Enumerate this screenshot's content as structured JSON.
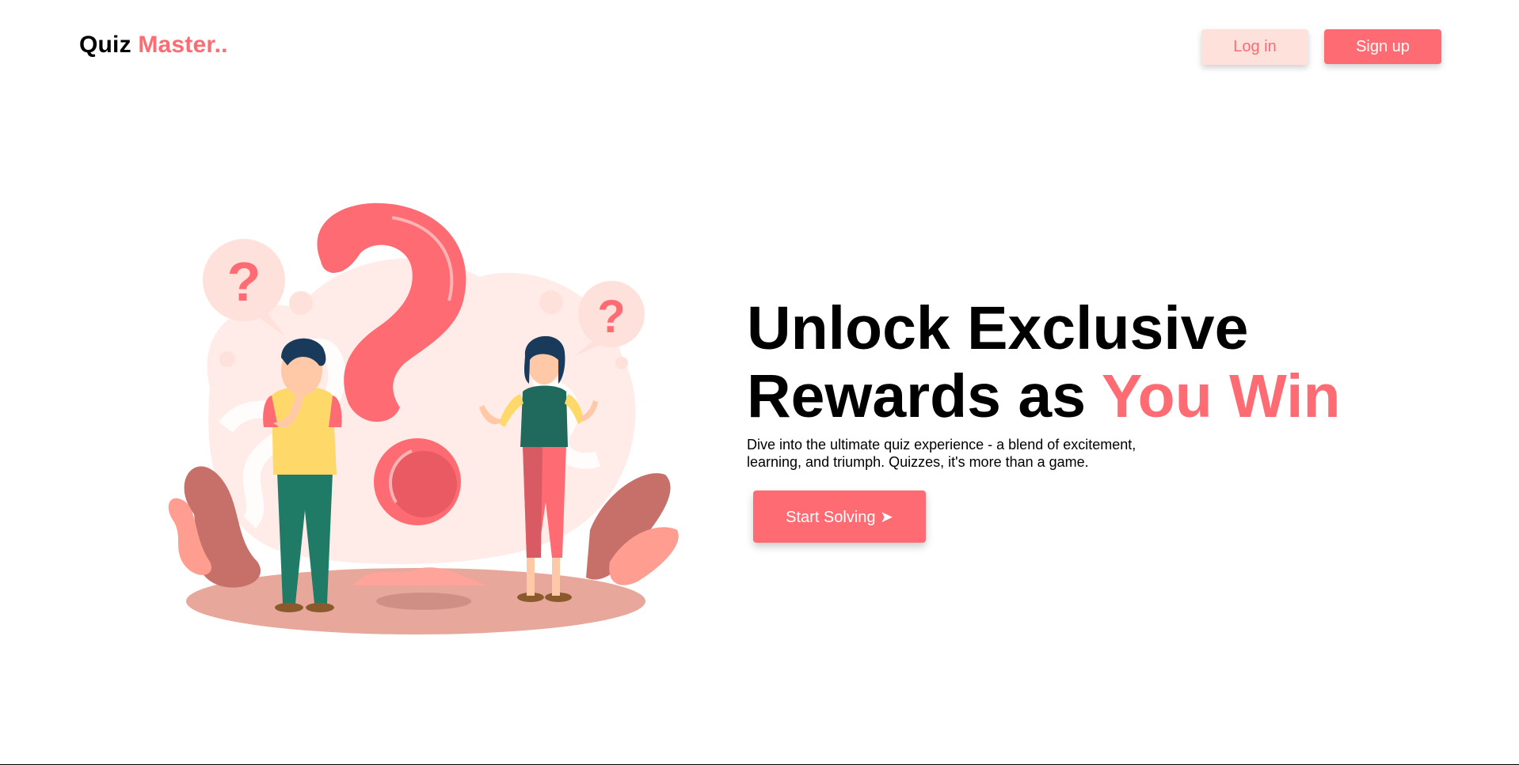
{
  "brand": {
    "name_part1": "Quiz ",
    "name_part2": "Master..",
    "accent_color": "#ff6b72"
  },
  "nav": {
    "login_label": "Log in",
    "signup_label": "Sign up"
  },
  "hero": {
    "title_line1": "Unlock Exclusive",
    "title_line2_plain": "Rewards as ",
    "title_line2_accent": "You Win",
    "description": "Dive into the ultimate quiz experience - a blend of excitement, learning, and triumph. Quizzes, it's more than a game.",
    "cta_label": "Start Solving ➤"
  },
  "illustration": {
    "icon": "question-people-illustration"
  }
}
